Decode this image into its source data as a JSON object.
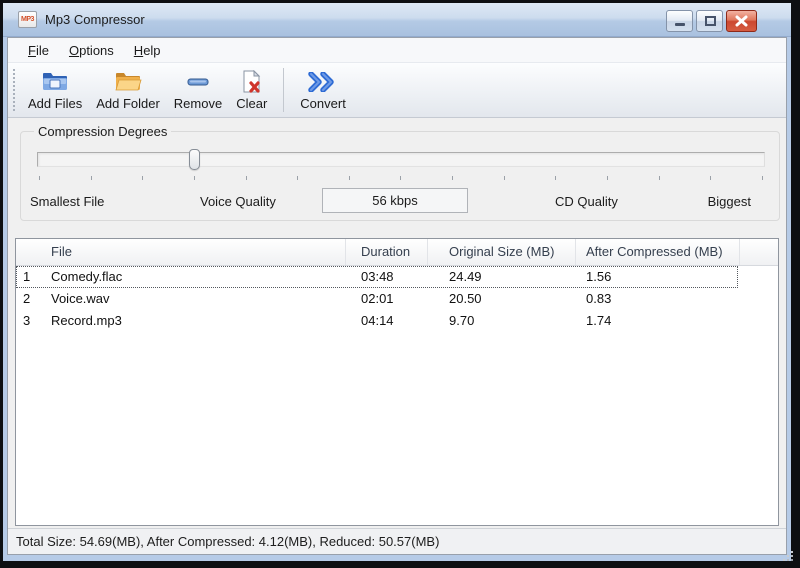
{
  "window": {
    "title": "Mp3 Compressor",
    "icon_text": "MP3",
    "controls": {
      "minimize": "minimize",
      "maximize": "maximize",
      "close": "close"
    }
  },
  "menu": {
    "items": [
      {
        "label": "File",
        "key": "F",
        "rest": "ile"
      },
      {
        "label": "Options",
        "key": "O",
        "rest": "ptions"
      },
      {
        "label": "Help",
        "key": "H",
        "rest": "elp"
      }
    ]
  },
  "toolbar": {
    "buttons": [
      {
        "label": "Add Files",
        "icon": "add-files-icon"
      },
      {
        "label": "Add Folder",
        "icon": "add-folder-icon"
      },
      {
        "label": "Remove",
        "icon": "remove-icon"
      },
      {
        "label": "Clear",
        "icon": "clear-icon"
      },
      {
        "label": "Convert",
        "icon": "convert-icon"
      }
    ]
  },
  "compression": {
    "group_label": "Compression Degrees",
    "slider": {
      "percent": 21.5,
      "tick_count": 15,
      "value": "56 kbps"
    },
    "scale_labels": {
      "smallest": "Smallest File",
      "voice": "Voice Quality",
      "current": "56 kbps",
      "cd": "CD Quality",
      "biggest": "Biggest"
    }
  },
  "table": {
    "columns": {
      "file": "File",
      "duration": "Duration",
      "original": "Original Size (MB)",
      "compressed": "After Compressed (MB)"
    },
    "rows": [
      {
        "num": "1",
        "file": "Comedy.flac",
        "duration": "03:48",
        "original": "24.49",
        "compressed": "1.56"
      },
      {
        "num": "2",
        "file": "Voice.wav",
        "duration": "02:01",
        "original": "20.50",
        "compressed": "0.83"
      },
      {
        "num": "3",
        "file": "Record.mp3",
        "duration": "04:14",
        "original": "9.70",
        "compressed": "1.74"
      }
    ],
    "selected_row": 1
  },
  "statusbar": {
    "text": "Total Size: 54.69(MB), After Compressed: 4.12(MB), Reduced: 50.57(MB)"
  },
  "colors": {
    "close_button": "#cc4830",
    "folder_blue": "#3a6fc4",
    "folder_yellow": "#e8a33d",
    "convert_blue": "#2e6bd4",
    "titlebar_top": "#dde8f5",
    "titlebar_bottom": "#a9c1df"
  }
}
